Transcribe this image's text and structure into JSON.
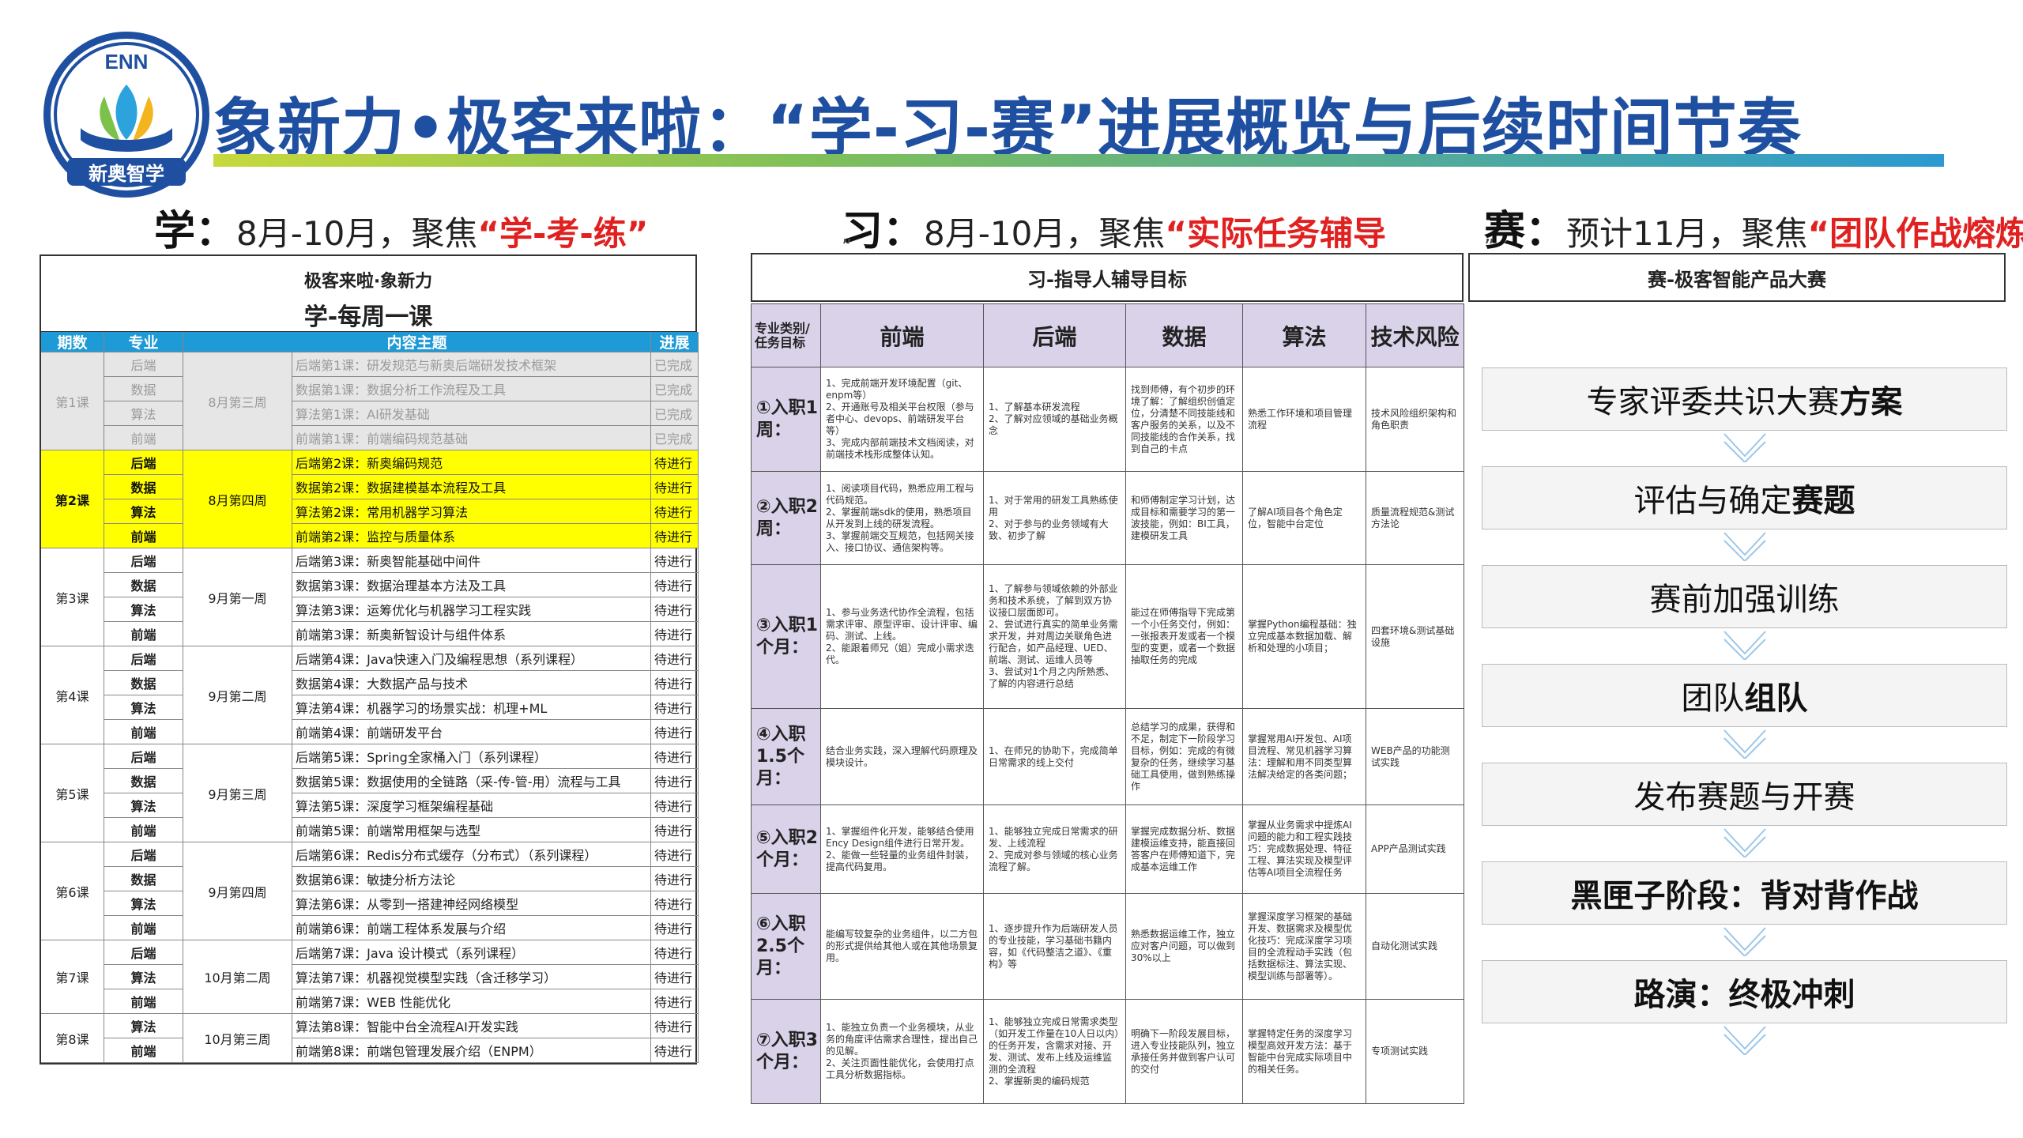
{
  "logo": {
    "top_text": "ENN",
    "bottom_text": "新奥智学"
  },
  "title": "象新力•极客来啦：“学-习-赛”进展概览与后续时间节奏",
  "sections": {
    "study": {
      "label": "学：",
      "period": "8月-10月，聚焦",
      "focus": "“学-考-练”"
    },
    "practice": {
      "label": "习：",
      "period": "8月-10月，聚焦",
      "focus": "“实际任务辅导",
      "tail": "”"
    },
    "contest": {
      "label": "赛：",
      "period": "预计11月，聚焦",
      "focus": "“团队作战熔炼",
      "tail": "”"
    }
  },
  "weekly": {
    "caption1": "极客来啦·象新力",
    "caption2": "学-每周一课",
    "headers": [
      "期数",
      "专业",
      "内容主题",
      "进展"
    ],
    "lessons": [
      {
        "name": "第1课",
        "week": "8月第三周",
        "style": "grey",
        "rows": [
          {
            "major": "后端",
            "topic": "后端第1课：研发规范与新奥后端研发技术框架",
            "status": "已完成"
          },
          {
            "major": "数据",
            "topic": "数据第1课：数据分析工作流程及工具",
            "status": "已完成"
          },
          {
            "major": "算法",
            "topic": "算法第1课：AI研发基础",
            "status": "已完成"
          },
          {
            "major": "前端",
            "topic": "前端第1课：前端编码规范基础",
            "status": "已完成"
          }
        ]
      },
      {
        "name": "第2课",
        "week": "8月第四周",
        "style": "yellow",
        "rows": [
          {
            "major": "后端",
            "topic": "后端第2课：新奥编码规范",
            "status": "待进行"
          },
          {
            "major": "数据",
            "topic": "数据第2课：数据建模基本流程及工具",
            "status": "待进行"
          },
          {
            "major": "算法",
            "topic": "算法第2课：常用机器学习算法",
            "status": "待进行"
          },
          {
            "major": "前端",
            "topic": "前端第2课：监控与质量体系",
            "status": "待进行"
          }
        ]
      },
      {
        "name": "第3课",
        "week": "9月第一周",
        "style": "normal",
        "rows": [
          {
            "major": "后端",
            "topic": "后端第3课：新奥智能基础中间件",
            "status": "待进行"
          },
          {
            "major": "数据",
            "topic": "数据第3课：数据治理基本方法及工具",
            "status": "待进行"
          },
          {
            "major": "算法",
            "topic": "算法第3课：运筹优化与机器学习工程实践",
            "status": "待进行"
          },
          {
            "major": "前端",
            "topic": "前端第3课：新奥新智设计与组件体系",
            "status": "待进行"
          }
        ]
      },
      {
        "name": "第4课",
        "week": "9月第二周",
        "style": "normal",
        "rows": [
          {
            "major": "后端",
            "topic": "后端第4课：Java快速入门及编程思想（系列课程）",
            "status": "待进行"
          },
          {
            "major": "数据",
            "topic": "数据第4课：大数据产品与技术",
            "status": "待进行"
          },
          {
            "major": "算法",
            "topic": "算法第4课：机器学习的场景实战：机理+ML",
            "status": "待进行"
          },
          {
            "major": "前端",
            "topic": "前端第4课：前端研发平台",
            "status": "待进行"
          }
        ]
      },
      {
        "name": "第5课",
        "week": "9月第三周",
        "style": "normal",
        "rows": [
          {
            "major": "后端",
            "topic": "后端第5课：Spring全家桶入门（系列课程）",
            "status": "待进行"
          },
          {
            "major": "数据",
            "topic": "数据第5课：数据使用的全链路（采-传-管-用）流程与工具",
            "status": "待进行"
          },
          {
            "major": "算法",
            "topic": "算法第5课：深度学习框架编程基础",
            "status": "待进行"
          },
          {
            "major": "前端",
            "topic": "前端第5课：前端常用框架与选型",
            "status": "待进行"
          }
        ]
      },
      {
        "name": "第6课",
        "week": "9月第四周",
        "style": "normal",
        "rows": [
          {
            "major": "后端",
            "topic": "后端第6课：Redis分布式缓存（分布式）（系列课程）",
            "status": "待进行"
          },
          {
            "major": "数据",
            "topic": "数据第6课：敏捷分析方法论",
            "status": "待进行"
          },
          {
            "major": "算法",
            "topic": "算法第6课：从零到一搭建神经网络模型",
            "status": "待进行"
          },
          {
            "major": "前端",
            "topic": "前端第6课：前端工程体系发展与介绍",
            "status": "待进行"
          }
        ]
      },
      {
        "name": "第7课",
        "week": "10月第二周",
        "style": "normal",
        "rows": [
          {
            "major": "后端",
            "topic": "后端第7课：Java 设计模式（系列课程）",
            "status": "待进行"
          },
          {
            "major": "算法",
            "topic": "算法第7课：机器视觉模型实践（含迁移学习）",
            "status": "待进行"
          },
          {
            "major": "前端",
            "topic": "前端第7课：WEB 性能优化",
            "status": "待进行"
          }
        ]
      },
      {
        "name": "第8课",
        "week": "10月第三周",
        "style": "normal",
        "rows": [
          {
            "major": "算法",
            "topic": "算法第8课：智能中台全流程AI开发实践",
            "status": "待进行"
          },
          {
            "major": "前端",
            "topic": "前端第8课：前端包管理发展介绍（ENPM）",
            "status": "待进行"
          }
        ]
      }
    ]
  },
  "mentor": {
    "caption": "习-指导人辅导目标",
    "corner_header": "专业类别/任务目标",
    "columns": [
      "前端",
      "后端",
      "数据",
      "算法",
      "技术风险"
    ],
    "rows": [
      {
        "label": "①入职1周：",
        "cells": [
          "1、完成前端开发环境配置（git、enpm等）\n2、开通账号及相关平台权限（参与者中心、devops、前端研发平台等）\n3、完成内部前端技术文档阅读，对前端技术栈形成整体认知。",
          "1、了解基本研发流程\n2、了解对应领域的基础业务概念",
          "找到师傅，有个初步的环境了解：了解组织创值定位，分清楚不同技能线和客户服务的关系，以及不同技能线的合作关系，找到自己的卡点",
          "熟悉工作环境和项目管理流程",
          "技术风险组织架构和角色职责"
        ]
      },
      {
        "label": "②入职2周：",
        "cells": [
          "1、阅读项目代码，熟悉应用工程与代码规范。\n2、掌握前端sdk的使用，熟悉项目从开发到上线的研发流程。\n3、掌握前端交互规范，包括网关接入、接口协议、通信架构等。",
          "1、对于常用的研发工具熟练使用\n2、对于参与的业务领域有大致、初步了解",
          "和师傅制定学习计划，达成目标和需要学习的第一波技能，例如：BI工具，建模研发工具",
          "了解AI项目各个角色定位，智能中台定位",
          "质量流程规范&测试方法论"
        ]
      },
      {
        "label": "③入职1个月：",
        "cells": [
          "1、参与业务迭代协作全流程，包括需求评审、原型评审、设计评审、编码、测试、上线。\n2、能跟着师兄（姐）完成小需求迭代。",
          "1、了解参与领域依赖的外部业务和技术系统，了解到双方协议接口层面即可。\n2、尝试进行真实的简单业务需求开发，并对周边关联角色进行配合，如产品经理、UED、前端、测试、运维人员等\n3、尝试对1个月之内所熟悉、了解的内容进行总结",
          "能过在师傅指导下完成第一个小任务交付，例如：一张报表开发或者一个模型的变更，或者一个数据抽取任务的完成",
          "掌握Python编程基础：独立完成基本数据加载、解析和处理的小项目；",
          "四套环境&测试基础设施"
        ]
      },
      {
        "label": "④入职1.5个月：",
        "cells": [
          "结合业务实践，深入理解代码原理及模块设计。",
          "1、在师兄的协助下，完成简单日常需求的线上交付",
          "总结学习的成果，获得和不足，制定下一阶段学习目标，例如：完成的有微复杂的任务，继续学习基础工具使用，做到熟练操作",
          "掌握常用AI开发包、AI项目流程、常见机器学习算法：理解和用不同类型算法解决给定的各类问题；",
          "WEB产品的功能测试实践"
        ]
      },
      {
        "label": "⑤入职2个月：",
        "cells": [
          "1、掌握组件化开发，能够结合使用Ency Design组件进行日常开发。\n2、能做一些轻量的业务组件封装，提高代码复用。",
          "1、能够独立完成日常需求的研发、上线流程\n2、完成对参与领域的核心业务流程了解。",
          "掌握完成数据分析、数据建模运维支持，能直接回答客户在师傅知道下，完成基本运维工作",
          "掌握从业务需求中提炼AI问题的能力和工程实践技巧：完成数据处理、特征工程、算法实现及模型评估等AI项目全流程任务",
          "APP产品测试实践"
        ]
      },
      {
        "label": "⑥入职2.5个月：",
        "cells": [
          "能编写较复杂的业务组件，以二方包的形式提供给其他人或在其他场景复用。",
          "1、逐步提升作为后端研发人员的专业技能，学习基础书籍内容，如《代码整洁之道》、《重构》等",
          "熟悉数据运维工作，独立应对客户问题，可以做到30%以上",
          "掌握深度学习框架的基础开发、数据需求及模型优化技巧：完成深度学习项目的全流程动手实践（包括数据标注、算法实现、模型训练与部署等）。",
          "自动化测试实践"
        ]
      },
      {
        "label": "⑦入职3个月：",
        "cells": [
          "1、能独立负责一个业务模块，从业务的角度评估需求合理性，提出自己的见解。\n2、关注页面性能优化，会使用打点工具分析数据指标。",
          "1、能够独立完成日常需求类型（如开发工作量在10人日以内）的任务开发，含需求对接、开发、测试、发布上线及运维监测的全流程\n2、掌握新奥的编码规范",
          "明确下一阶段发展目标，进入专业技能队列，独立承接任务并做到客户认可的交付",
          "掌握特定任务的深度学习模型高效开发方法：基于智能中台完成实际项目中的相关任务。",
          "专项测试实践"
        ]
      }
    ]
  },
  "contest": {
    "caption": "赛-极客智能产品大赛",
    "steps": [
      {
        "text": "专家评委共识大赛",
        "em": "方案",
        "all_bold": false
      },
      {
        "text": "评估与确定",
        "em": "赛题",
        "all_bold": false
      },
      {
        "text": "赛前加强训练",
        "em": "",
        "all_bold": false
      },
      {
        "text": "团队",
        "em": "组队",
        "all_bold": false
      },
      {
        "text": "发布赛题与开赛",
        "em": "",
        "all_bold": false
      },
      {
        "text": "黑匣子阶段：背对背作战",
        "em": "",
        "all_bold": true
      },
      {
        "text": "路演：终极冲刺",
        "em": "",
        "all_bold": true
      }
    ]
  },
  "colors": {
    "brand_blue": "#1f4fa0",
    "header_cyan": "#1e9ad6",
    "highlight_yellow": "#ffff00",
    "accent_red": "#e12020",
    "purple_header": "#d9d2e9"
  }
}
